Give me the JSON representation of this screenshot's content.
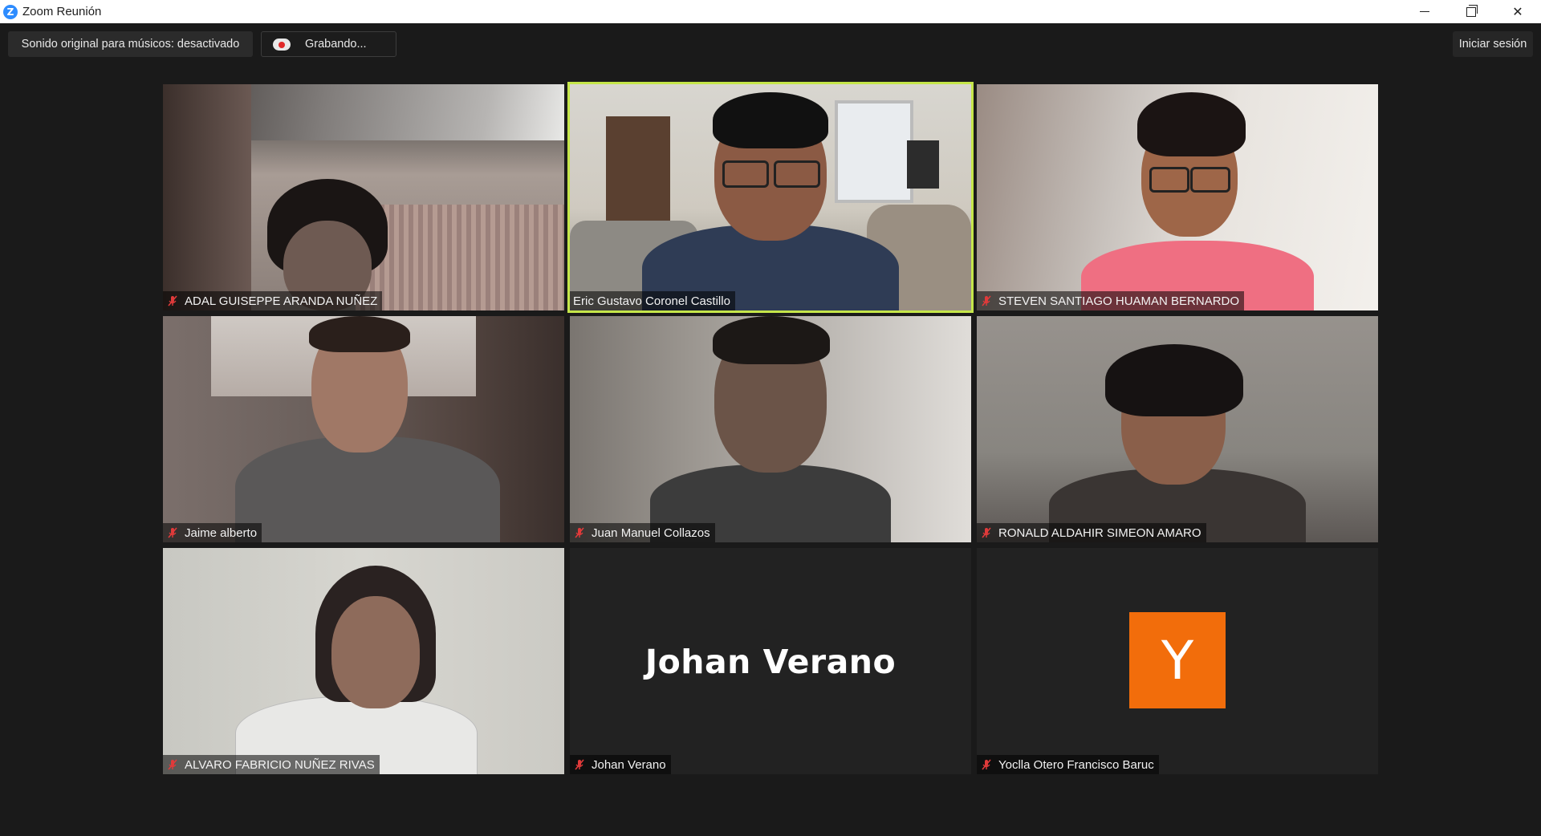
{
  "window": {
    "title": "Zoom Reunión",
    "logo_letter": "Z",
    "controls": {
      "minimize": "minimize",
      "maximize": "restore",
      "close": "✕"
    }
  },
  "topbar": {
    "sound_label": "Sonido original para músicos: desactivado",
    "recording_label": "Grabando...",
    "signin_label": "Iniciar sesión"
  },
  "colors": {
    "active_speaker_border": "#c5e64a",
    "avatar_bg": "#F26D0B",
    "muted_icon": "#e03a3a",
    "zoom_blue": "#2D8CFF"
  },
  "participants": [
    {
      "name": "ADAL GUISEPPE ARANDA NUÑEZ",
      "muted": true,
      "video": true
    },
    {
      "name": "Eric Gustavo Coronel Castillo",
      "muted": false,
      "video": true,
      "active_speaker": true
    },
    {
      "name": "STEVEN SANTIAGO HUAMAN BERNARDO",
      "muted": true,
      "video": true
    },
    {
      "name": "Jaime alberto",
      "muted": true,
      "video": true
    },
    {
      "name": "Juan Manuel Collazos",
      "muted": true,
      "video": true
    },
    {
      "name": "RONALD ALDAHIR SIMEON AMARO",
      "muted": true,
      "video": true
    },
    {
      "name": "ALVARO FABRICIO NUÑEZ RIVAS",
      "muted": true,
      "video": true
    },
    {
      "name": "Johan Verano",
      "muted": true,
      "video": false,
      "display_name": "Johan Verano"
    },
    {
      "name": "Yoclla Otero Francisco Baruc",
      "muted": true,
      "video": false,
      "avatar_letter": "Y"
    }
  ]
}
